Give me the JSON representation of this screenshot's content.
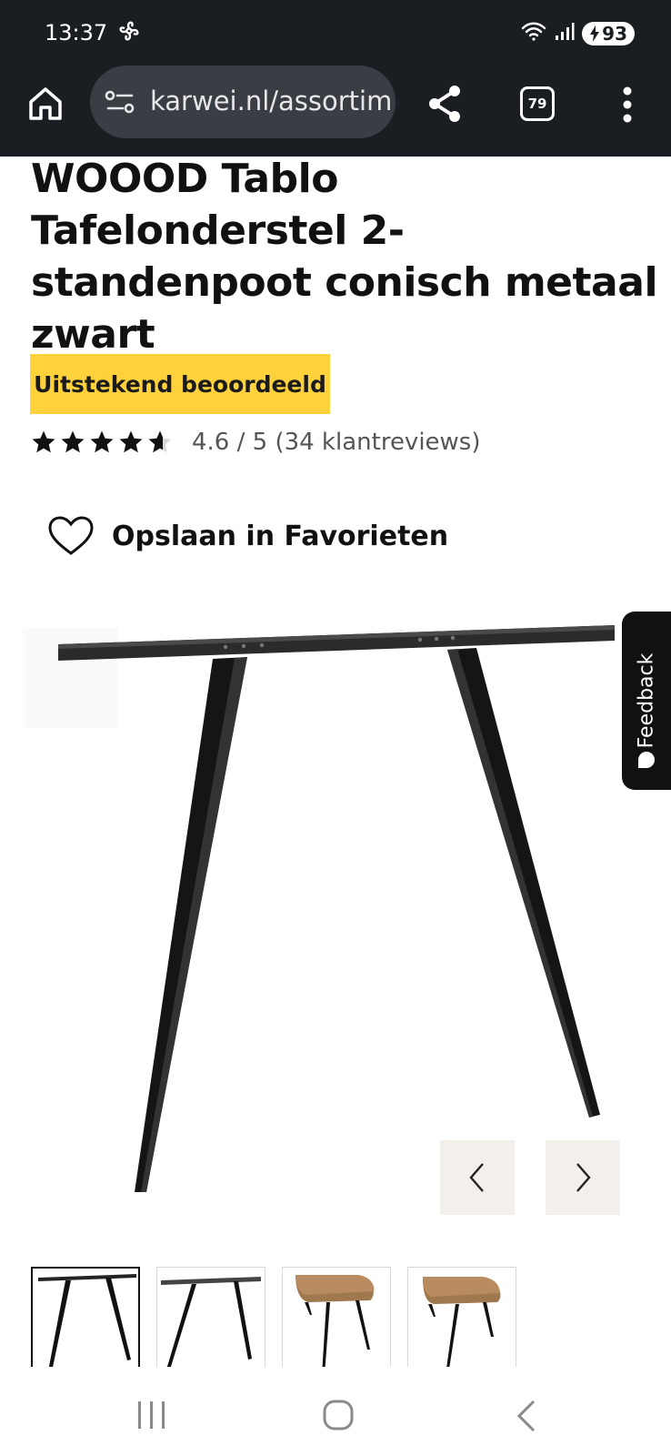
{
  "status_bar": {
    "time": "13:37",
    "battery": "93"
  },
  "browser": {
    "url": "karwei.nl/assortim",
    "tab_count": "79"
  },
  "product": {
    "title": "WOOOD Tablo Tafelonderstel 2-standenpoot conisch metaal zwart",
    "badge": "Uitstekend beoordeeld",
    "rating_value": 4.6,
    "rating_text": "4.6 / 5 (34 klantreviews)",
    "favorite_label": "Opslaan in Favorieten"
  },
  "feedback": {
    "label": "Feedback"
  },
  "gallery": {
    "thumbnail_count": 4,
    "active_index": 0
  },
  "colors": {
    "browser_bar": "#1a1d22",
    "badge_bg": "#ffd23c",
    "nav_btn_bg": "#f3f0ec",
    "text": "#111111"
  },
  "icons": {
    "home": "home-icon",
    "site_settings": "tune-icon",
    "share": "share-icon",
    "menu": "more-vert-icon",
    "favorite": "heart-icon",
    "prev": "chevron-left-icon",
    "next": "chevron-right-icon"
  }
}
